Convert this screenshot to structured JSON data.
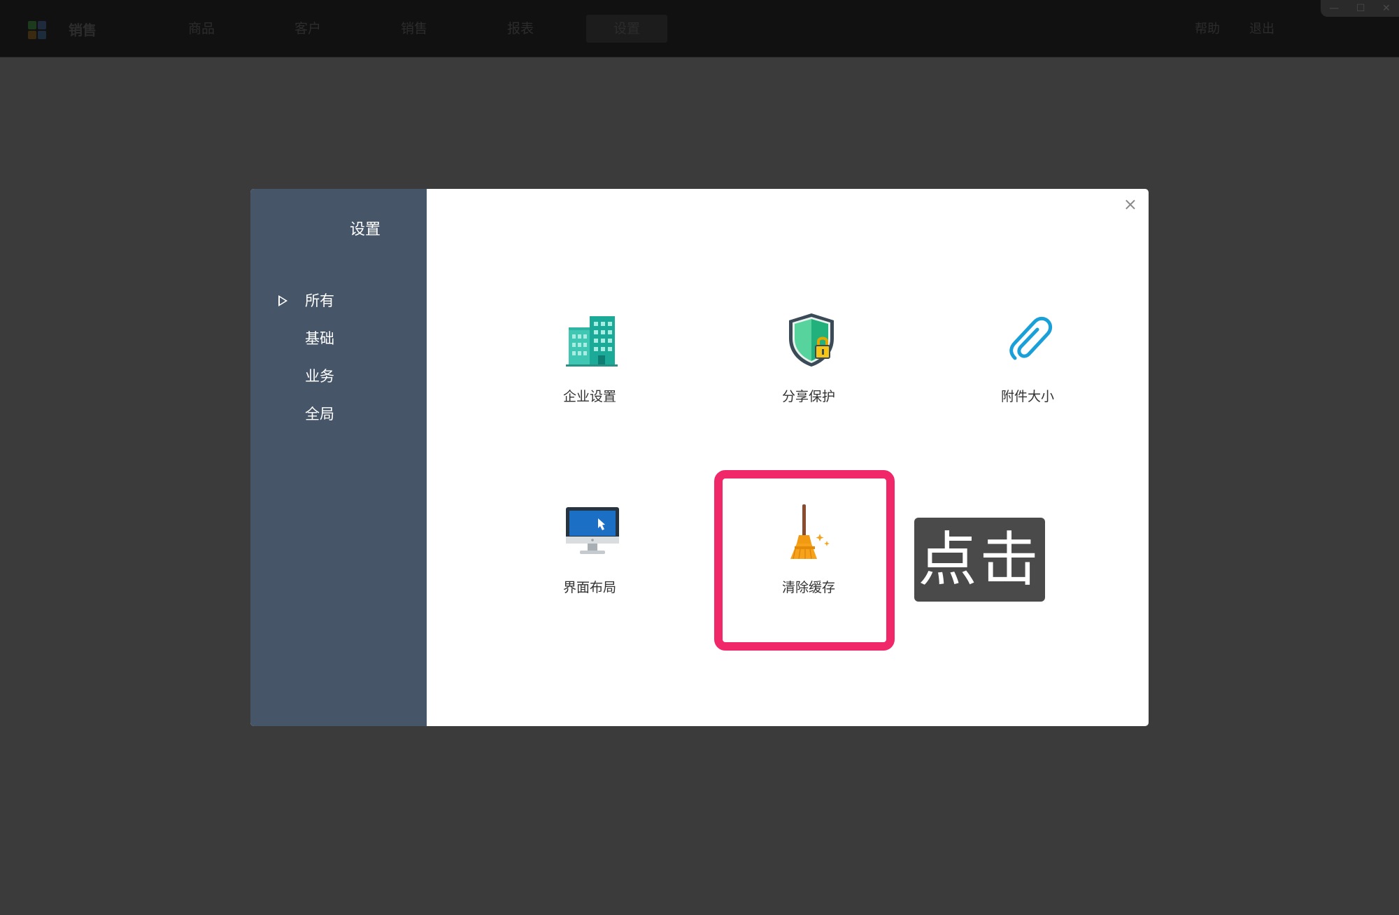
{
  "app": {
    "brand": "销售",
    "nav": [
      {
        "label": "商品"
      },
      {
        "label": "客户"
      },
      {
        "label": "销售"
      },
      {
        "label": "报表"
      },
      {
        "label": "设置",
        "active": true
      }
    ],
    "right_links": [
      "帮助",
      "退出"
    ],
    "window_controls": [
      "—",
      "☐",
      "✕"
    ]
  },
  "modal": {
    "sidebar": {
      "title": "设置",
      "items": [
        {
          "label": "所有",
          "selected": true
        },
        {
          "label": "基础"
        },
        {
          "label": "业务"
        },
        {
          "label": "全局"
        }
      ]
    },
    "close_glyph": "×",
    "tiles": [
      {
        "label": "企业设置",
        "icon": "building-icon"
      },
      {
        "label": "分享保护",
        "icon": "shield-lock-icon"
      },
      {
        "label": "附件大小",
        "icon": "paperclip-icon"
      },
      {
        "label": "界面布局",
        "icon": "monitor-icon"
      },
      {
        "label": "清除缓存",
        "icon": "broom-icon",
        "highlighted": true
      }
    ]
  },
  "annotation": {
    "tooltip_text": "点击",
    "highlight_color": "#f0286a"
  },
  "colors": {
    "sidebar_bg": "#465568",
    "overlay_bg": "#3b3b3b",
    "topbar_bg": "#111111"
  }
}
